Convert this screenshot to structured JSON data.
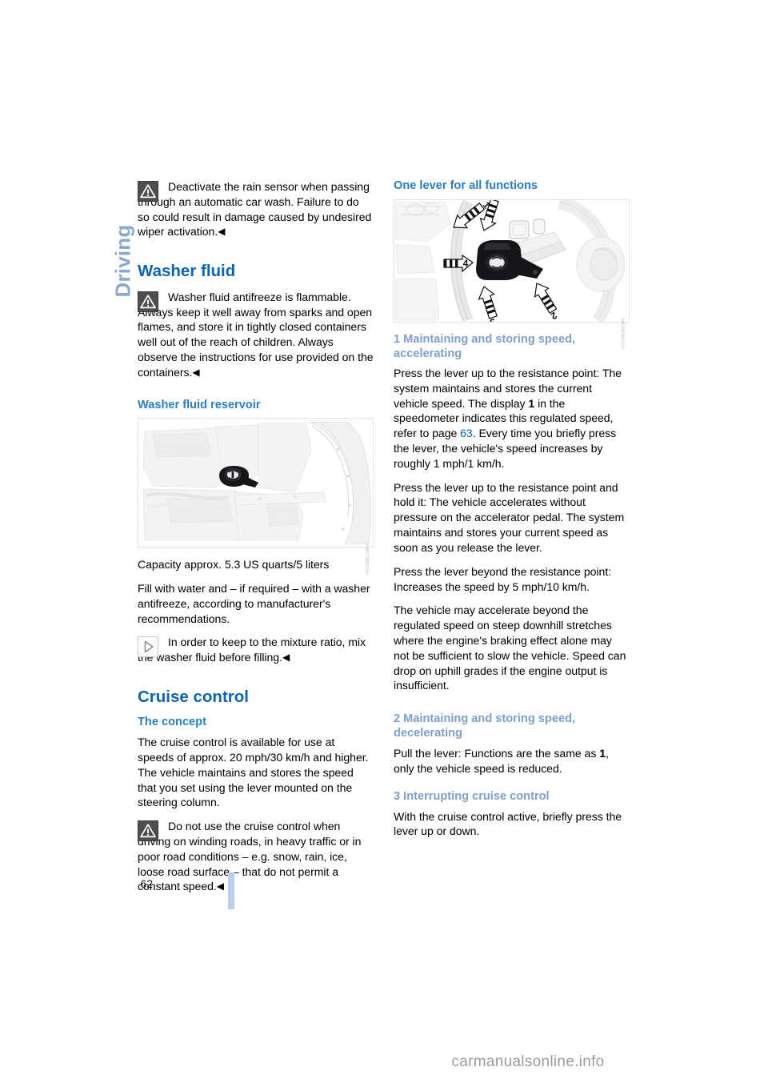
{
  "chapter": {
    "label": "Driving"
  },
  "page": {
    "number": "62",
    "watermark": "carmanualsonline.info"
  },
  "left_column": {
    "blocks": [
      {
        "type": "note",
        "icon": "warning-icon",
        "text": "Deactivate the rain sensor when passing through an automatic car wash. Failure to do so could result in damage caused by undesired wiper activation.",
        "endmark": "◀"
      },
      {
        "type": "h1",
        "text": "Washer fluid"
      },
      {
        "type": "note",
        "icon": "warning-icon",
        "text": "Washer fluid antifreeze is flammable. Always keep it well away from sparks and open flames, and store it in tightly closed containers well out of the reach of children. Always observe the instructions for use provided on the containers.",
        "endmark": "◀"
      },
      {
        "type": "h2",
        "text": "Washer fluid reservoir"
      },
      {
        "type": "figure",
        "name": "washer-fluid-reservoir-figure",
        "code": "VVO3I9ECOMV"
      },
      {
        "type": "p",
        "text": "Capacity approx. 5.3 US quarts/5 liters"
      },
      {
        "type": "p",
        "text": "Fill with water and – if required – with a washer antifreeze, according to manufacturer's recommendations."
      },
      {
        "type": "note",
        "icon": "note-icon",
        "text": "In order to keep to the mixture ratio, mix the washer fluid before filling.",
        "endmark": "◀"
      },
      {
        "type": "h1",
        "text": "Cruise control"
      },
      {
        "type": "h2",
        "text": "The concept"
      },
      {
        "type": "p",
        "text": "The cruise control is available for use at speeds of approx. 20 mph/30 km/h and higher. The vehicle maintains and stores the speed that you set using the lever mounted on the steering column."
      },
      {
        "type": "note",
        "icon": "warning-icon",
        "text": "Do not use the cruise control when driving on winding roads, in heavy traffic or in poor road conditions – e.g. snow, rain, ice, loose road surface – that do not permit a constant speed.",
        "endmark": "◀"
      }
    ]
  },
  "right_column": {
    "heading": "One lever for all functions",
    "figure": {
      "name": "cruise-control-lever-figure",
      "code": "VVO3I81EOMS",
      "callouts": [
        "1",
        "2",
        "3",
        "3",
        "4"
      ]
    },
    "sections": [
      {
        "heading": "1 Maintaining and storing speed, accelerating",
        "paragraphs": [
          {
            "runs": [
              {
                "t": "Press the lever up to the resistance point: The system maintains and stores the current vehicle speed. The display "
              },
              {
                "t": "1",
                "style": "bold"
              },
              {
                "t": " in the speedometer indicates this regulated speed, refer to page "
              },
              {
                "t": "63",
                "style": "pageref"
              },
              {
                "t": ". Every time you briefly press the lever, the vehicle's speed increases by roughly 1 mph/1 km/h."
              }
            ]
          },
          {
            "runs": [
              {
                "t": "Press the lever up to the resistance point and hold it: The vehicle accelerates without pressure on the accelerator pedal. The system maintains and stores your current speed as soon as you release the lever."
              }
            ]
          },
          {
            "runs": [
              {
                "t": "Press the lever beyond the resistance point: Increases the speed by 5 mph/10 km/h."
              }
            ]
          },
          {
            "runs": [
              {
                "t": "The vehicle may accelerate beyond the regulated speed on steep downhill stretches where the engine's braking effect alone may not be sufficient to slow the vehicle. Speed can drop on uphill grades if the engine output is insufficient."
              }
            ]
          }
        ]
      },
      {
        "heading": "2 Maintaining and storing speed, decelerating",
        "paragraphs": [
          {
            "runs": [
              {
                "t": "Pull the lever: Functions are the same as "
              },
              {
                "t": "1",
                "style": "bold"
              },
              {
                "t": ", only the vehicle speed is reduced."
              }
            ]
          }
        ]
      },
      {
        "heading": "3 Interrupting cruise control",
        "paragraphs": [
          {
            "runs": [
              {
                "t": "With the cruise control active, briefly press the lever up or down."
              }
            ]
          }
        ]
      }
    ]
  },
  "colors": {
    "heading_primary": "#0a64b0",
    "heading_secondary": "#2a7ec0",
    "heading_numbered": "#7d9fc9",
    "chapter_tab": "#8aa9d0",
    "page_rule": "#bdcfe8",
    "body_text": "#000000",
    "watermark": "#9b9b9b"
  }
}
